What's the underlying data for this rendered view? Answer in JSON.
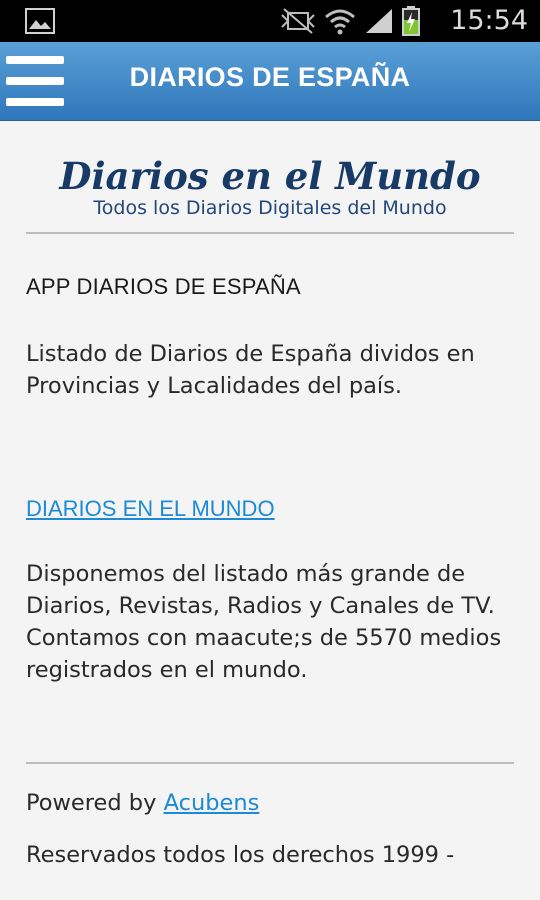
{
  "status_bar": {
    "time": "15:54",
    "icons": [
      "gallery-icon",
      "mute-icon",
      "wifi-icon",
      "signal-icon",
      "battery-charging-icon"
    ]
  },
  "action_bar": {
    "title": "DIARIOS DE ESPAÑA",
    "menu_icon": "hamburger-menu-icon"
  },
  "logo": {
    "title": "Diarios en el Mundo",
    "subtitle": "Todos los Diarios Digitales del Mundo"
  },
  "section1": {
    "heading": "APP DIARIOS DE ESPAÑA",
    "text": "Listado de Diarios de España dividos en Provincias y Lacalidades del país."
  },
  "section2": {
    "link": "DIARIOS EN EL MUNDO",
    "text": "Disponemos del listado más grande de Diarios, Revistas, Radios y Canales de TV. Contamos con maacute;s de 5570 medios registrados en el mundo."
  },
  "footer": {
    "powered_prefix": "Powered by",
    "powered_link": "Acubens",
    "rights": "Reservados todos los derechos 1999 -"
  },
  "colors": {
    "action_bar": "#3f88c8",
    "link": "#1d8ad6",
    "logo": "#173a66"
  }
}
